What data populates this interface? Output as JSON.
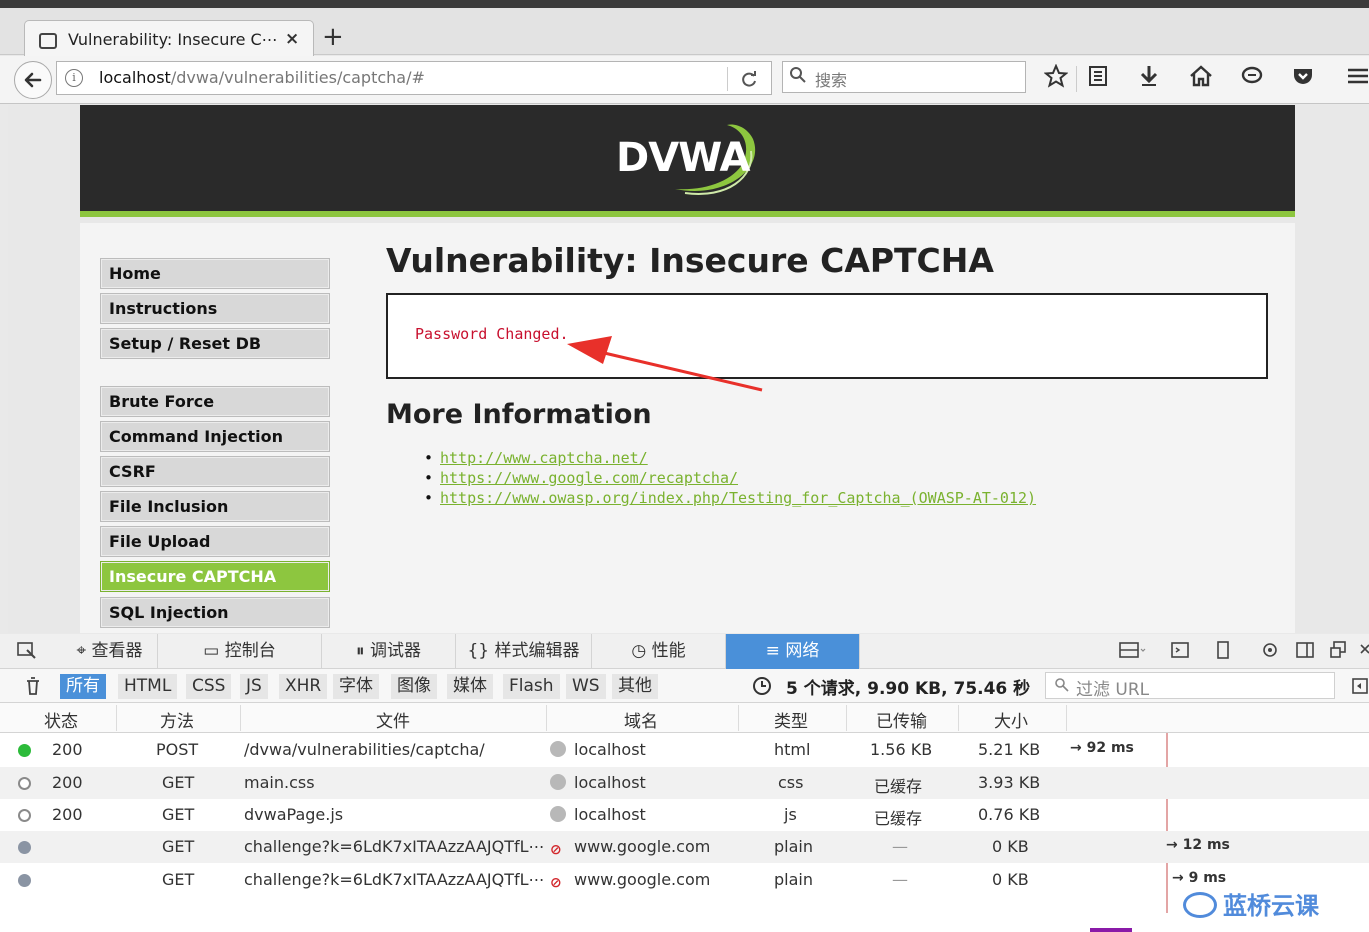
{
  "browser": {
    "tab_title": "Vulnerability: Insecure C⋯",
    "tab_close": "×",
    "new_tab": "+",
    "url_host": "localhost",
    "url_path": "/dvwa/vulnerabilities/captcha/#",
    "search_placeholder": "搜索",
    "toolbar_icons": [
      "star-icon",
      "reading-list-icon",
      "download-icon",
      "home-icon",
      "chat-icon",
      "pocket-icon",
      "menu-icon"
    ]
  },
  "dvwa": {
    "logo_text": "DVWA",
    "menu_group1": [
      "Home",
      "Instructions",
      "Setup / Reset DB"
    ],
    "menu_group2": [
      "Brute Force",
      "Command Injection",
      "CSRF",
      "File Inclusion",
      "File Upload",
      "Insecure CAPTCHA",
      "SQL Injection"
    ],
    "active_menu": "Insecure CAPTCHA",
    "page_title": "Vulnerability: Insecure CAPTCHA",
    "message": "Password Changed.",
    "more_title": "More Information",
    "links": [
      "http://www.captcha.net/",
      "https://www.google.com/recaptcha/",
      "https://www.owasp.org/index.php/Testing_for_Captcha_(OWASP-AT-012)"
    ],
    "accent_color": "#8dc63f",
    "message_color": "#c8102e"
  },
  "devtools": {
    "tabs": [
      "查看器",
      "控制台",
      "调试器",
      "样式编辑器",
      "性能",
      "网络"
    ],
    "active_tab": "网络",
    "filters": [
      "所有",
      "HTML",
      "CSS",
      "JS",
      "XHR",
      "字体",
      "图像",
      "媒体",
      "Flash",
      "WS",
      "其他"
    ],
    "active_filter": "所有",
    "summary": "5 个请求, 9.90 KB, 75.46 秒",
    "url_filter_placeholder": "过滤 URL",
    "columns": [
      "状态",
      "方法",
      "文件",
      "域名",
      "类型",
      "已传输",
      "大小"
    ],
    "requests": [
      {
        "dot": "green",
        "status": "200",
        "method": "POST",
        "file": "/dvwa/vulnerabilities/captcha/",
        "domain": "localhost",
        "domain_icon": "globe",
        "type": "html",
        "transferred": "1.56 KB",
        "size": "5.21 KB",
        "timing": "→ 92 ms"
      },
      {
        "dot": "hollow",
        "status": "200",
        "method": "GET",
        "file": "main.css",
        "domain": "localhost",
        "domain_icon": "globe",
        "type": "css",
        "transferred": "已缓存",
        "size": "3.93 KB",
        "timing": ""
      },
      {
        "dot": "hollow",
        "status": "200",
        "method": "GET",
        "file": "dvwaPage.js",
        "domain": "localhost",
        "domain_icon": "globe",
        "type": "js",
        "transferred": "已缓存",
        "size": "0.76 KB",
        "timing": ""
      },
      {
        "dot": "grey",
        "status": "",
        "method": "GET",
        "file": "challenge?k=6LdK7xITAAzzAAJQTfL⋯",
        "domain": "www.google.com",
        "domain_icon": "blocked",
        "type": "plain",
        "transferred": "—",
        "size": "0 KB",
        "timing": "→ 12 ms"
      },
      {
        "dot": "grey",
        "status": "",
        "method": "GET",
        "file": "challenge?k=6LdK7xITAAzzAAJQTfL⋯",
        "domain": "www.google.com",
        "domain_icon": "blocked",
        "type": "plain",
        "transferred": "—",
        "size": "0 KB",
        "timing": "→ 9 ms"
      }
    ]
  },
  "watermark": "蓝桥云课"
}
